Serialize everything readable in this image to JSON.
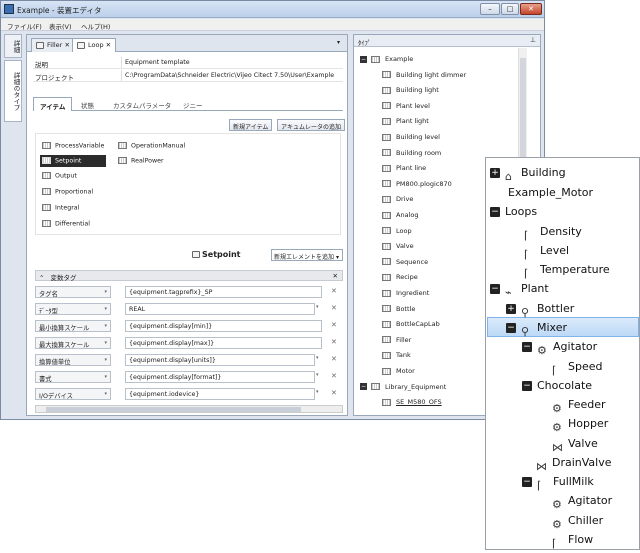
{
  "window": {
    "title": "Example - 装置エディタ",
    "btn_min": "–",
    "btn_max": "□",
    "btn_close": "✕"
  },
  "menu": [
    "ファイル(F)",
    "表示(V)",
    "ヘルプ(H)"
  ],
  "sidebar": {
    "tab1": "詳細",
    "tab2": "詳細のタイプ"
  },
  "editor": {
    "tabs": [
      {
        "label": "Filler"
      },
      {
        "label": "Loop"
      }
    ],
    "tab_close": "✕",
    "dropdown": "▾",
    "props": [
      {
        "key": "説明",
        "value": "Equipment template"
      },
      {
        "key": "プロジェクト",
        "value": "C:\\ProgramData\\Schneider Electric\\Vijeo Citect 7.50\\User\\Example"
      }
    ],
    "subtabs": [
      "アイテム",
      "状態",
      "カスタムパラメータ",
      "ジニー"
    ],
    "new_item": "新規アイテム",
    "add_accumulator": "アキュムレータの追加",
    "items_col1": [
      "ProcessVariable",
      "Setpoint",
      "Output",
      "Proportional",
      "Integral",
      "Differential"
    ],
    "items_col2": [
      "OperationManual",
      "RealPower"
    ],
    "selected_item": "Setpoint",
    "add_element": "新規エレメントを追加",
    "add_element_arrow": "▾",
    "group_header": "変数タグ",
    "group_toggle": "⌃",
    "group_close": "✕",
    "dd_arrow": "▾",
    "row_remove": "✕",
    "rows": [
      {
        "key": "タグ名",
        "value": "{equipment.tagprefix}_SP"
      },
      {
        "key": "ﾃﾞｰﾀ型",
        "value": "REAL"
      },
      {
        "key": "最小換算スケール",
        "value": "{equipment.display[min]}"
      },
      {
        "key": "最大換算スケール",
        "value": "{equipment.display[max]}"
      },
      {
        "key": "換算値単位",
        "value": "{equipment.display[units]}"
      },
      {
        "key": "書式",
        "value": "{equipment.display[format]}"
      },
      {
        "key": "I/Oデバイス",
        "value": "{equipment.iodevice}"
      }
    ]
  },
  "types_panel": {
    "title": "ﾀｲﾌﾟ",
    "pin": "⊥",
    "expander": "−",
    "groups": [
      {
        "name": "Example",
        "items": [
          "Building light dimmer",
          "Building light",
          "Plant level",
          "Plant light",
          "Building level",
          "Building room",
          "Plant line",
          "PM800.plogic870",
          "Drive",
          "Analog",
          "Loop",
          "Valve",
          "Sequence",
          "Recipe",
          "Ingredient",
          "Bottle",
          "BottleCapLab",
          "Filler",
          "Tank",
          "Motor"
        ]
      },
      {
        "name": "Library_Equipment",
        "items": [
          "SE_M580_OFS"
        ]
      }
    ]
  },
  "tree": {
    "plus": "+",
    "minus": "−",
    "nodes": [
      "Building",
      "Example_Motor",
      "Loops",
      "Density",
      "Level",
      "Temperature",
      "Plant",
      "Bottler",
      "Mixer",
      "Agitator",
      "Speed",
      "Chocolate",
      "Feeder",
      "Hopper",
      "Valve",
      "DrainValve",
      "FullMilk",
      "Agitator",
      "Chiller",
      "Flow"
    ]
  }
}
